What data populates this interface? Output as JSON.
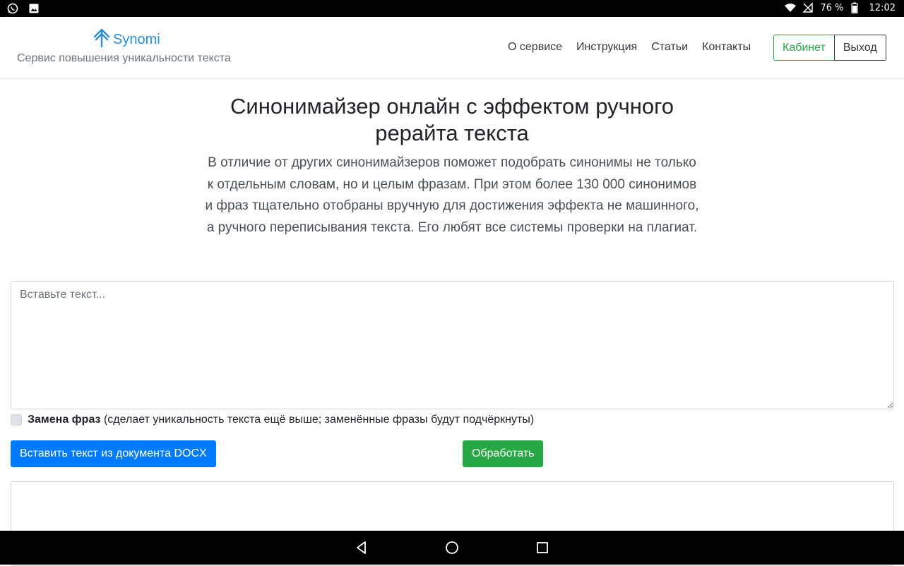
{
  "status_bar": {
    "battery": "76 %",
    "time": "12:02",
    "left_icons": [
      "whatsapp-icon",
      "image-icon"
    ],
    "right_icons": [
      "wifi-icon",
      "no-signal-icon",
      "battery-icon"
    ]
  },
  "header": {
    "brand": "Synomi",
    "tagline": "Сервис повышения уникальности текста",
    "nav": [
      "О сервисе",
      "Инструкция",
      "Статьи",
      "Контакты"
    ],
    "cabinet_label": "Кабинет",
    "exit_label": "Выход",
    "colors": {
      "brand": "#2d8fd8",
      "success": "#28a745"
    }
  },
  "main": {
    "title": "Синонимайзер онлайн с эффектом ручного рерайта текста",
    "lead": "В отличие от других синонимайзеров поможет подобрать синонимы не только к отдельным словам, но и целым фразам. При этом более 130 000 синонимов и фраз тщательно отобраны вручную для достижения эффекта не машинного, а ручного переписывания текста. Его любят все системы проверки на плагиат.",
    "input_placeholder": "Вставьте текст...",
    "input_value": "",
    "option_bold": "Замена фраз",
    "option_text": "(сделает уникальность текста ещё выше; заменённые фразы будут подчёркнуты)",
    "docx_button": "Вставить текст из документа DOCX",
    "process_button": "Обработать",
    "colors": {
      "primary": "#007bff",
      "success": "#28a745"
    }
  },
  "android_nav": [
    "back-icon",
    "home-icon",
    "recents-icon"
  ]
}
